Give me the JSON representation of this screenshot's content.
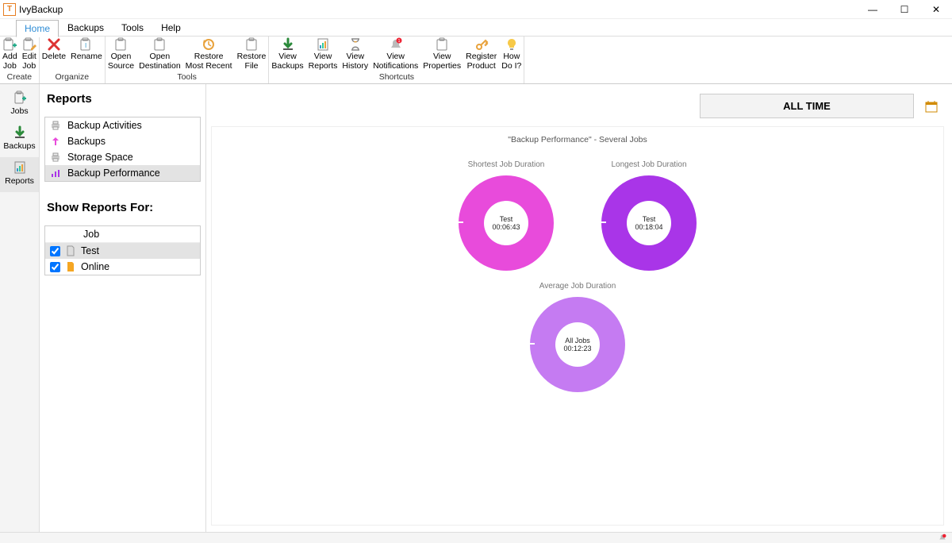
{
  "app": {
    "title": "IvyBackup"
  },
  "menubar": {
    "items": [
      "Home",
      "Backups",
      "Tools",
      "Help"
    ],
    "active": "Home"
  },
  "ribbon": {
    "groups": [
      {
        "label": "Create",
        "buttons": [
          {
            "name": "add-job",
            "label1": "Add",
            "label2": "Job",
            "icon": "plus"
          },
          {
            "name": "edit-job",
            "label1": "Edit",
            "label2": "Job",
            "icon": "pencil"
          }
        ]
      },
      {
        "label": "Organize",
        "buttons": [
          {
            "name": "delete",
            "label1": "Delete",
            "label2": "",
            "icon": "x-red"
          },
          {
            "name": "rename",
            "label1": "Rename",
            "label2": "",
            "icon": "rename"
          }
        ]
      },
      {
        "label": "Tools",
        "buttons": [
          {
            "name": "open-source",
            "label1": "Open",
            "label2": "Source",
            "icon": "clip"
          },
          {
            "name": "open-destination",
            "label1": "Open",
            "label2": "Destination",
            "icon": "clip"
          },
          {
            "name": "restore-recent",
            "label1": "Restore",
            "label2": "Most Recent",
            "icon": "restore"
          },
          {
            "name": "restore-file",
            "label1": "Restore",
            "label2": "File",
            "icon": "clip"
          }
        ]
      },
      {
        "label": "Shortcuts",
        "buttons": [
          {
            "name": "view-backups",
            "label1": "View",
            "label2": "Backups",
            "icon": "down-green"
          },
          {
            "name": "view-reports",
            "label1": "View",
            "label2": "Reports",
            "icon": "report"
          },
          {
            "name": "view-history",
            "label1": "View",
            "label2": "History",
            "icon": "hourglass"
          },
          {
            "name": "view-notifications",
            "label1": "View",
            "label2": "Notifications",
            "icon": "bell-badge"
          },
          {
            "name": "view-properties",
            "label1": "View",
            "label2": "Properties",
            "icon": "clip"
          },
          {
            "name": "register-product",
            "label1": "Register",
            "label2": "Product",
            "icon": "key"
          },
          {
            "name": "how-do-i",
            "label1": "How",
            "label2": "Do I?",
            "icon": "bulb"
          }
        ]
      }
    ]
  },
  "left_rail": {
    "items": [
      {
        "name": "jobs",
        "label": "Jobs",
        "icon": "clip-plus"
      },
      {
        "name": "backups",
        "label": "Backups",
        "icon": "down-green"
      },
      {
        "name": "reports",
        "label": "Reports",
        "icon": "report",
        "selected": true
      }
    ]
  },
  "reports": {
    "panel_title": "Reports",
    "items": [
      {
        "name": "backup-activities",
        "label": "Backup Activities"
      },
      {
        "name": "backups-report",
        "label": "Backups"
      },
      {
        "name": "storage-space",
        "label": "Storage Space"
      },
      {
        "name": "backup-performance",
        "label": "Backup Performance",
        "selected": true
      }
    ]
  },
  "show_for": {
    "title": "Show Reports For:",
    "header": "Job",
    "rows": [
      {
        "name": "job-test",
        "label": "Test",
        "checked": true,
        "selected": true,
        "icon": "page-grey"
      },
      {
        "name": "job-online",
        "label": "Online",
        "checked": true,
        "selected": false,
        "icon": "page-orange"
      }
    ]
  },
  "time_filter": {
    "label": "ALL TIME"
  },
  "chart_data": {
    "title": "\"Backup Performance\" - Several Jobs",
    "charts": [
      {
        "type": "pie",
        "subtype": "donut",
        "title": "Shortest Job Duration",
        "series": [
          {
            "name": "Test",
            "value_label": "00:06:43",
            "value_seconds": 403,
            "fraction": 1.0
          }
        ],
        "color": "#e84bdb"
      },
      {
        "type": "pie",
        "subtype": "donut",
        "title": "Longest  Job Duration",
        "series": [
          {
            "name": "Test",
            "value_label": "00:18:04",
            "value_seconds": 1084,
            "fraction": 1.0
          }
        ],
        "color": "#a935e8"
      },
      {
        "type": "pie",
        "subtype": "donut",
        "title": "Average Job Duration",
        "series": [
          {
            "name": "All Jobs",
            "value_label": "00:12:23",
            "value_seconds": 743,
            "fraction": 1.0
          }
        ],
        "color": "#c57bf2"
      }
    ]
  }
}
